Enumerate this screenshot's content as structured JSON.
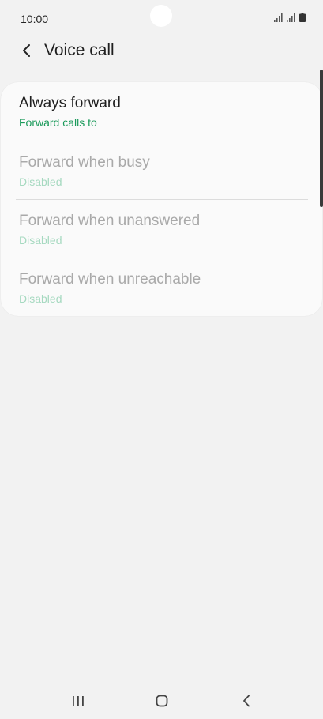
{
  "status_bar": {
    "time": "10:00"
  },
  "header": {
    "back_icon": "chevron-left-icon",
    "title": "Voice call"
  },
  "options": [
    {
      "title": "Always forward",
      "subtitle": "Forward calls to",
      "enabled": true
    },
    {
      "title": "Forward when busy",
      "subtitle": "Disabled",
      "enabled": false
    },
    {
      "title": "Forward when unanswered",
      "subtitle": "Disabled",
      "enabled": false
    },
    {
      "title": "Forward when unreachable",
      "subtitle": "Disabled",
      "enabled": false
    }
  ],
  "colors": {
    "accent": "#1a9a5a",
    "accent_disabled": "#a6d9c0",
    "text_primary": "#1f1f1f",
    "text_disabled": "#a9a9a9",
    "background": "#f2f2f2",
    "card": "#fafafa"
  },
  "nav_bar": {
    "recents_icon": "recents-icon",
    "home_icon": "home-icon",
    "back_icon": "back-icon"
  }
}
